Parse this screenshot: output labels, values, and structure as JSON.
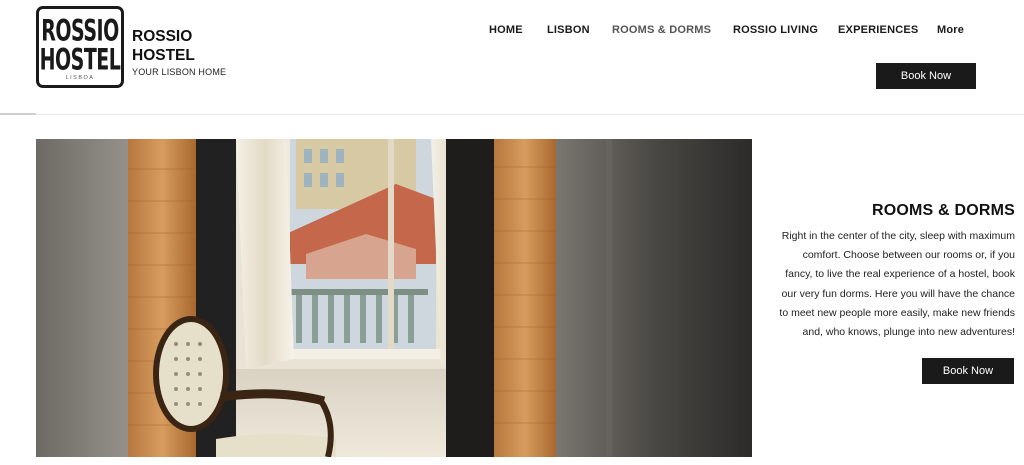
{
  "logo": {
    "line1": "ROSSIO",
    "line2": "HOSTEL",
    "sub": "LISBOA"
  },
  "brand": {
    "name": "ROSSIO HOSTEL",
    "tagline": "YOUR LISBON HOME"
  },
  "nav": {
    "items": [
      {
        "label": "HOME"
      },
      {
        "label": "LISBON"
      },
      {
        "label": "ROOMS & DORMS",
        "active": true
      },
      {
        "label": "ROSSIO LIVING"
      },
      {
        "label": "EXPERIENCES"
      },
      {
        "label": "More"
      }
    ]
  },
  "header": {
    "book_now": "Book Now"
  },
  "section": {
    "title": "ROOMS & DORMS",
    "body": "Right in the center of the city, sleep with maximum comfort. Choose between our rooms or, if you fancy, to live the real experience of a hostel, book our very fun dorms. Here you will have the chance to meet new people more easily, make new friends and, who knows, plunge into new adventures!",
    "book_now": "Book Now"
  },
  "colors": {
    "button_bg": "#1a1a1a",
    "button_text": "#ffffff",
    "active_nav": "#555555"
  }
}
